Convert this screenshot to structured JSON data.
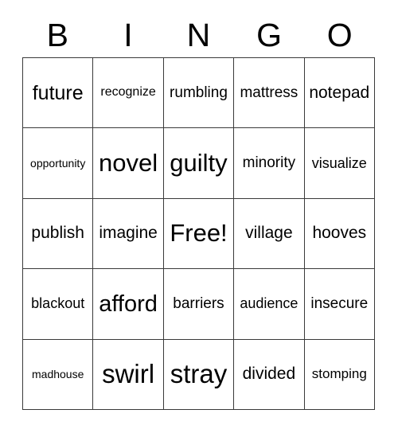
{
  "card": {
    "title": "BINGO",
    "header_letters": [
      "B",
      "I",
      "N",
      "G",
      "O"
    ],
    "columns": 5,
    "rows": 5,
    "free_space_label": "Free!",
    "free_space_position": "center",
    "colors": {
      "background": "#ffffff",
      "text": "#000000",
      "grid_line": "#3a3a3a"
    }
  },
  "grid": {
    "rows": [
      {
        "cells": [
          {
            "text": "future",
            "size": "fs-xl"
          },
          {
            "text": "recognize",
            "size": "fs-s"
          },
          {
            "text": "rumbling",
            "size": "fs-ml"
          },
          {
            "text": "mattress",
            "size": "fs-ml"
          },
          {
            "text": "notepad",
            "size": "fs-l"
          }
        ]
      },
      {
        "cells": [
          {
            "text": "opportunity",
            "size": "fs-xs"
          },
          {
            "text": "novel",
            "size": "fs-3xl"
          },
          {
            "text": "guilty",
            "size": "fs-3xl"
          },
          {
            "text": "minority",
            "size": "fs-ml"
          },
          {
            "text": "visualize",
            "size": "fs-m"
          }
        ]
      },
      {
        "cells": [
          {
            "text": "publish",
            "size": "fs-l"
          },
          {
            "text": "imagine",
            "size": "fs-l"
          },
          {
            "text": "Free!",
            "size": "fs-3xl"
          },
          {
            "text": "village",
            "size": "fs-l"
          },
          {
            "text": "hooves",
            "size": "fs-l"
          }
        ]
      },
      {
        "cells": [
          {
            "text": "blackout",
            "size": "fs-m"
          },
          {
            "text": "afford",
            "size": "fs-2xl"
          },
          {
            "text": "barriers",
            "size": "fs-ml"
          },
          {
            "text": "audience",
            "size": "fs-m"
          },
          {
            "text": "insecure",
            "size": "fs-ml"
          }
        ]
      },
      {
        "cells": [
          {
            "text": "madhouse",
            "size": "fs-xs"
          },
          {
            "text": "swirl",
            "size": "fs-4xl"
          },
          {
            "text": "stray",
            "size": "fs-4xl"
          },
          {
            "text": "divided",
            "size": "fs-l"
          },
          {
            "text": "stomping",
            "size": "fs-sm"
          }
        ]
      }
    ]
  }
}
